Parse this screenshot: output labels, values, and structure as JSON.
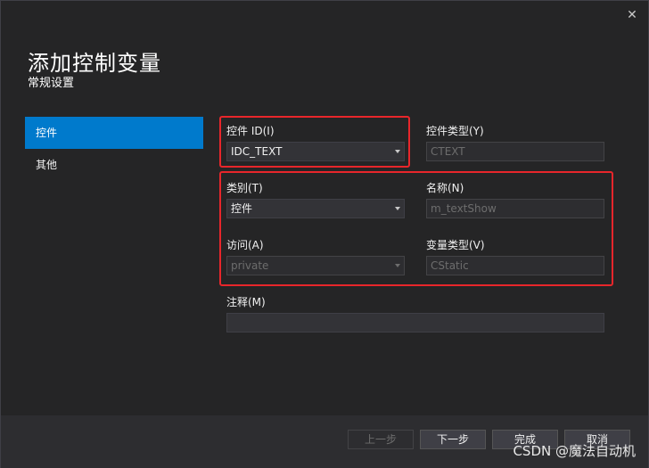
{
  "window": {
    "close_glyph": "✕"
  },
  "header": {
    "title": "添加控制变量",
    "subtitle": "常规设置"
  },
  "sidebar": {
    "items": [
      {
        "label": "控件",
        "active": true
      },
      {
        "label": "其他",
        "active": false
      }
    ]
  },
  "form": {
    "control_id": {
      "label": "控件 ID(I)",
      "value": "IDC_TEXT"
    },
    "control_type": {
      "label": "控件类型(Y)",
      "value": "CTEXT"
    },
    "category": {
      "label": "类别(T)",
      "value": "控件"
    },
    "name": {
      "label": "名称(N)",
      "value": "m_textShow"
    },
    "access": {
      "label": "访问(A)",
      "value": "private"
    },
    "variable_type": {
      "label": "变量类型(V)",
      "value": "CStatic"
    },
    "comment": {
      "label": "注释(M)",
      "value": ""
    }
  },
  "footer": {
    "prev_label": "上一步",
    "next_label": "下一步",
    "finish_label": "完成",
    "cancel_label": "取消"
  },
  "watermark": "CSDN @魔法自动机",
  "colors": {
    "accent": "#007acc",
    "highlight_box": "#e8262b",
    "background": "#252526"
  }
}
